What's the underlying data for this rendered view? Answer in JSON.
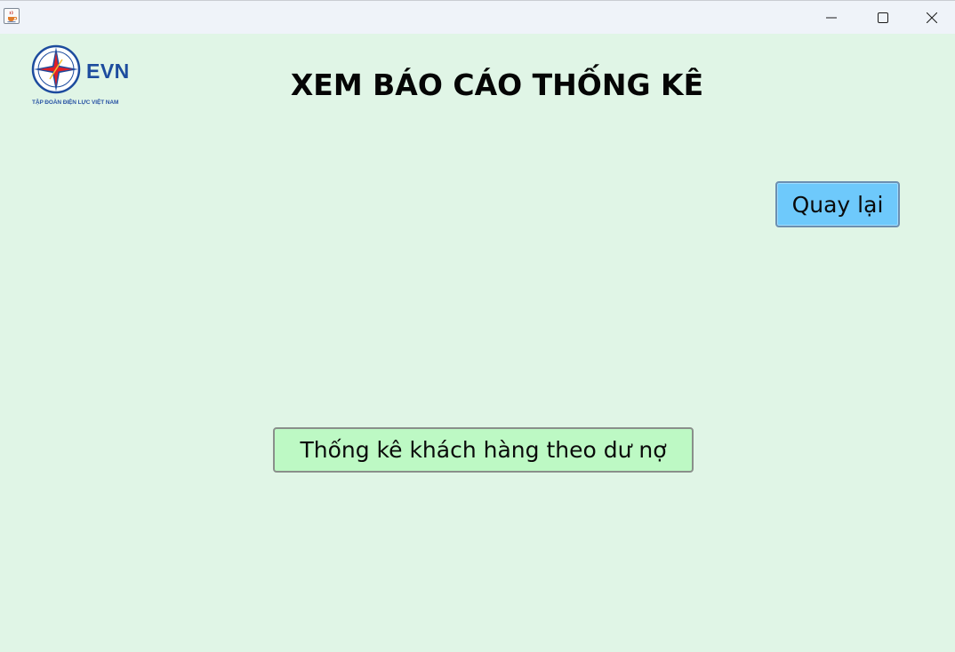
{
  "window": {
    "controls": {
      "minimize_icon": "minimize-icon",
      "maximize_icon": "maximize-icon",
      "close_icon": "close-icon"
    },
    "app_icon": "java-cup-icon"
  },
  "logo": {
    "name": "EVN",
    "subtitle": "TẬP ĐOÀN ĐIỆN LỰC VIỆT NAM",
    "colors": {
      "blue": "#1d4c9e",
      "red": "#e21f26"
    }
  },
  "header": {
    "title": "XEM BÁO CÁO THỐNG KÊ"
  },
  "actions": {
    "back_label": "Quay lại",
    "report_label": "Thống kê khách hàng theo dư nợ"
  },
  "colors": {
    "background": "#e0f5e6",
    "titlebar": "#eff3f9",
    "back_button": "#6ec9fb",
    "report_button": "#bdf9c4"
  }
}
